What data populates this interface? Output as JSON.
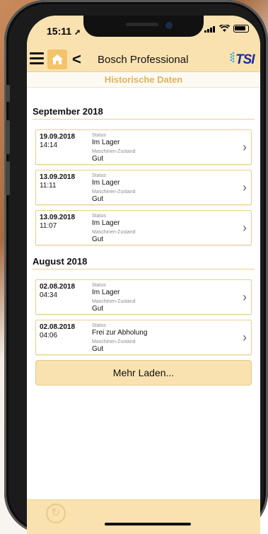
{
  "status_bar": {
    "time": "15:11",
    "location_glyph": "➚"
  },
  "nav": {
    "title": "Bosch Professional",
    "back_glyph": "<",
    "logo_text": "TSI"
  },
  "subheader": {
    "title": "Historische Daten"
  },
  "sections": [
    {
      "title": "September 2018",
      "entries": [
        {
          "date": "19.09.2018",
          "time": "14:14",
          "status_label": "Status",
          "status": "Im Lager",
          "condition_label": "Maschinen-Zustand",
          "condition": "Gut"
        },
        {
          "date": "13.09.2018",
          "time": "11:11",
          "status_label": "Status",
          "status": "Im Lager",
          "condition_label": "Maschinen-Zustand",
          "condition": "Gut"
        },
        {
          "date": "13.09.2018",
          "time": "11:07",
          "status_label": "Status",
          "status": "Im Lager",
          "condition_label": "Maschinen-Zustand",
          "condition": "Gut"
        }
      ]
    },
    {
      "title": "August 2018",
      "entries": [
        {
          "date": "02.08.2018",
          "time": "04:34",
          "status_label": "Status",
          "status": "Im Lager",
          "condition_label": "Maschinen-Zustand",
          "condition": "Gut"
        },
        {
          "date": "02.08.2018",
          "time": "04:06",
          "status_label": "Status",
          "status": "Frei zur Abholung",
          "condition_label": "Maschinen-Zustand",
          "condition": "Gut"
        }
      ]
    }
  ],
  "more_button": {
    "label": "Mehr Laden..."
  },
  "icons": {
    "menu": "menu-icon",
    "home": "home-icon",
    "back": "back-icon",
    "chevron": "chevron-right-icon",
    "refresh": "refresh-icon",
    "wifi": "wifi-icon",
    "battery": "battery-icon",
    "signal": "signal-icon"
  },
  "colors": {
    "accent": "#f9e2b0",
    "home_button": "#f4c46a",
    "section_rule": "#e7cf8f",
    "subheader_text": "#e3b258",
    "logo": "#1a2d9c"
  }
}
